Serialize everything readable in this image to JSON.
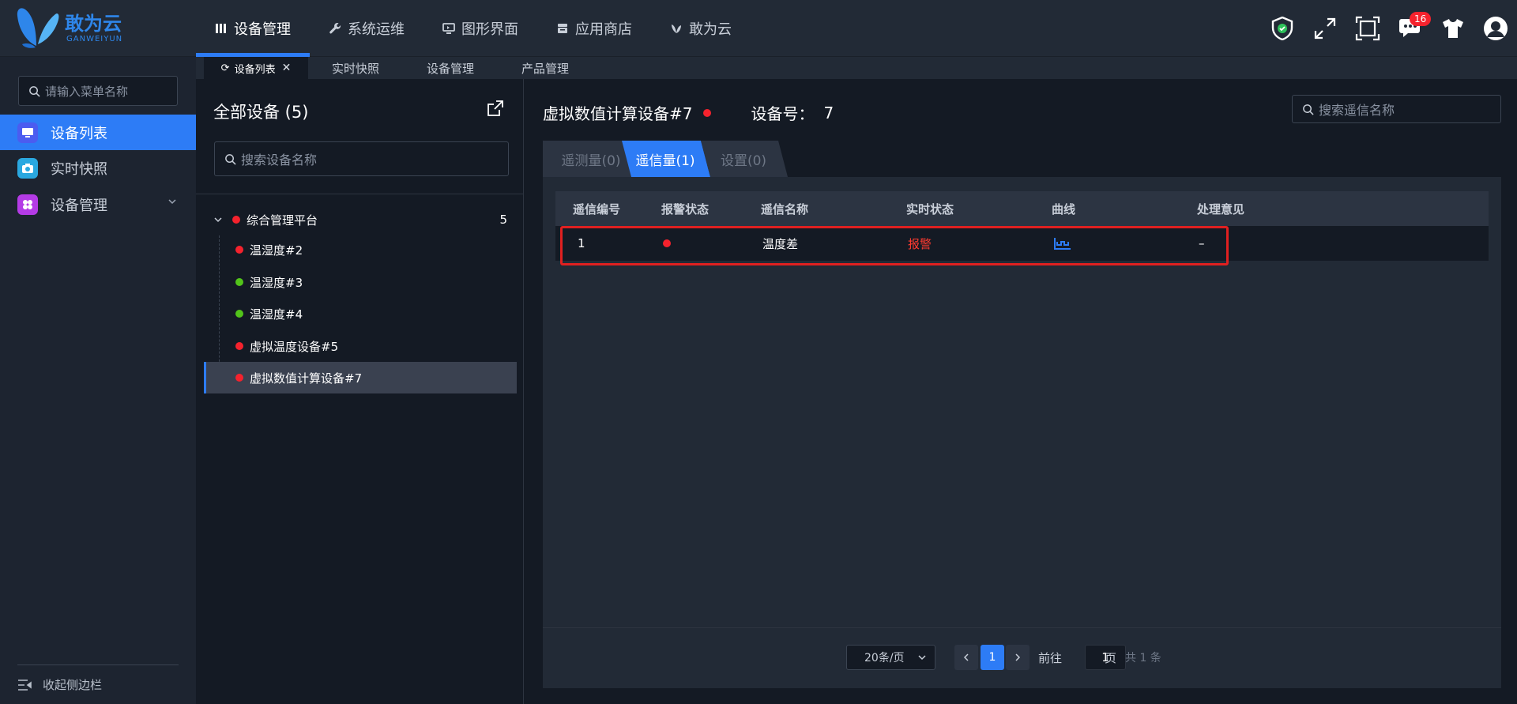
{
  "app": {
    "logo_cn": "敢为云",
    "logo_en": "GANWEIYUN"
  },
  "topnav": [
    {
      "label": "设备管理",
      "icon": "columns-icon",
      "active": true
    },
    {
      "label": "系统运维",
      "icon": "wrench-icon"
    },
    {
      "label": "图形界面",
      "icon": "monitor-icon"
    },
    {
      "label": "应用商店",
      "icon": "store-icon"
    },
    {
      "label": "敢为云",
      "icon": "butterfly-icon"
    }
  ],
  "topicons": {
    "shield": "shield-check-icon",
    "expand": "expand-arrows-icon",
    "fullscreen": "fullscreen-frame-icon",
    "messages": "chat-icon",
    "messages_badge": "16",
    "skin": "tshirt-icon",
    "user": "user-avatar-icon"
  },
  "sidebar": {
    "search_placeholder": "请输入菜单名称",
    "items": [
      {
        "label": "设备列表",
        "icon": "monitor-icon",
        "active": true,
        "color": "#4b5cf0"
      },
      {
        "label": "实时快照",
        "icon": "camera-icon",
        "color": "#2aa8e0"
      },
      {
        "label": "设备管理",
        "icon": "grid-icon",
        "color": "#b43be6"
      }
    ],
    "collapse_label": "收起侧边栏"
  },
  "tabstrip": [
    {
      "label": "设备列表",
      "active": true
    },
    {
      "label": "实时快照"
    },
    {
      "label": "设备管理"
    },
    {
      "label": "产品管理"
    }
  ],
  "tree": {
    "title": "全部设备 (5)",
    "search_placeholder": "搜索设备名称",
    "root": {
      "label": "综合管理平台",
      "count": "5",
      "status": "alarm"
    },
    "nodes": [
      {
        "label": "温湿度#2",
        "status": "alarm"
      },
      {
        "label": "温湿度#3",
        "status": "normal"
      },
      {
        "label": "温湿度#4",
        "status": "normal"
      },
      {
        "label": "虚拟温度设备#5",
        "status": "alarm"
      },
      {
        "label": "虚拟数值计算设备#7",
        "status": "alarm",
        "active": true
      }
    ]
  },
  "detail": {
    "device_name": "虚拟数值计算设备#7",
    "device_no_label": "设备号：",
    "device_no": "7",
    "search_placeholder": "搜索遥信名称",
    "tabs": [
      {
        "label": "遥测量(0)"
      },
      {
        "label": "遥信量(1)",
        "active": true
      },
      {
        "label": "设置(0)"
      }
    ],
    "columns": [
      "遥信编号",
      "报警状态",
      "遥信名称",
      "实时状态",
      "曲线",
      "处理意见"
    ],
    "rows": [
      {
        "id": "1",
        "alarm": "alarm",
        "name": "温度差",
        "state": "报警",
        "curve": "curve-chart-icon",
        "note": "–"
      }
    ],
    "pager": {
      "page_size": "20条/页",
      "current": "1",
      "goto_label": "前往",
      "goto_value": "1",
      "page_unit": "页",
      "total": "共 1 条"
    }
  },
  "colors": {
    "accent": "#2d7cf6",
    "alarm": "#f5222d",
    "normal": "#52c41a",
    "alarm_text": "#ff3b30",
    "highlight_box": "#e02020"
  }
}
